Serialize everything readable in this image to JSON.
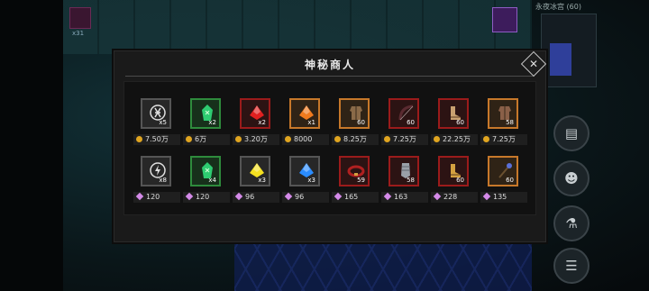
{
  "background": {
    "map_name": "永夜冰宫 (60)",
    "skill_count": "x31"
  },
  "shop": {
    "title": "神秘商人",
    "close_icon": "close-icon",
    "currency_icons": {
      "gold": "gold-coin-icon",
      "diamond": "diamond-icon"
    },
    "rows": [
      [
        {
          "name": "rune-icon",
          "qty": "x5",
          "price": "7.50万",
          "currency": "gold",
          "tier": "gray",
          "color": "#e0e0e0"
        },
        {
          "name": "green-rune-crystal-icon",
          "qty": "x2",
          "price": "6万",
          "currency": "gold",
          "tier": "green",
          "color": "#2ecc71"
        },
        {
          "name": "red-gem-icon",
          "qty": "x2",
          "price": "3.20万",
          "currency": "gold",
          "tier": "red",
          "color": "#e02020"
        },
        {
          "name": "orange-gem-icon",
          "qty": "x1",
          "price": "8000",
          "currency": "gold",
          "tier": "orange",
          "color": "#f07a1e"
        },
        {
          "name": "leather-armor-icon",
          "qty": "60",
          "price": "8.25万",
          "currency": "gold",
          "tier": "orange",
          "color": "#8a6a48"
        },
        {
          "name": "dark-bow-icon",
          "qty": "60",
          "price": "7.25万",
          "currency": "gold",
          "tier": "red",
          "color": "#5a2a30"
        },
        {
          "name": "red-boots-icon",
          "qty": "60",
          "price": "22.25万",
          "currency": "gold",
          "tier": "red",
          "color": "#c8a070"
        },
        {
          "name": "plate-armor-icon",
          "qty": "58",
          "price": "7.25万",
          "currency": "gold",
          "tier": "orange",
          "color": "#8a6048"
        }
      ],
      [
        {
          "name": "lightning-rune-icon",
          "qty": "x8",
          "price": "120",
          "currency": "diamond",
          "tier": "gray",
          "color": "#e0e0e0"
        },
        {
          "name": "green-rune-crystal-icon",
          "qty": "x4",
          "price": "120",
          "currency": "diamond",
          "tier": "green",
          "color": "#2ecc71"
        },
        {
          "name": "yellow-gem-icon",
          "qty": "x3",
          "price": "96",
          "currency": "diamond",
          "tier": "gray",
          "color": "#f4e020"
        },
        {
          "name": "blue-gem-icon",
          "qty": "x3",
          "price": "96",
          "currency": "diamond",
          "tier": "gray",
          "color": "#2a8cff"
        },
        {
          "name": "red-belt-icon",
          "qty": "59",
          "price": "165",
          "currency": "diamond",
          "tier": "red",
          "color": "#b02020"
        },
        {
          "name": "gauntlet-icon",
          "qty": "58",
          "price": "163",
          "currency": "diamond",
          "tier": "red",
          "color": "#9aa0a8"
        },
        {
          "name": "golden-boots-icon",
          "qty": "60",
          "price": "228",
          "currency": "diamond",
          "tier": "red",
          "color": "#d4a040"
        },
        {
          "name": "staff-icon",
          "qty": "60",
          "price": "135",
          "currency": "diamond",
          "tier": "orange",
          "color": "#5a70d8"
        }
      ]
    ]
  }
}
